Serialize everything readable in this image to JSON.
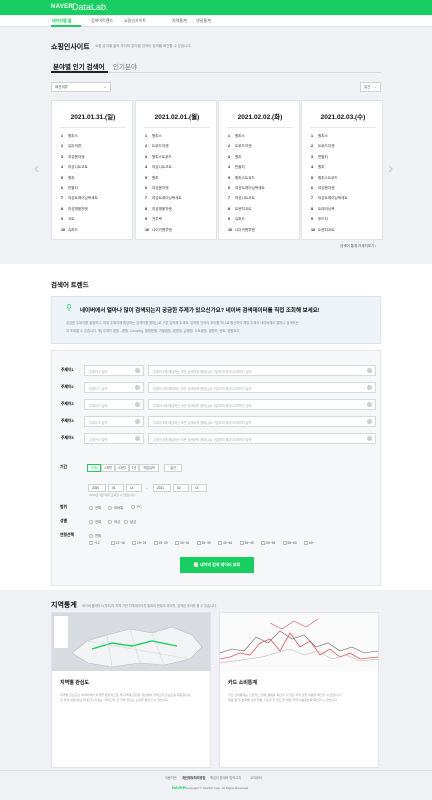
{
  "header": {
    "brand": "NAVER",
    "title": "DataLab."
  },
  "nav": [
    {
      "label": "데이터랩 홈"
    },
    {
      "label": "검색어트렌드"
    },
    {
      "label": "쇼핑인사이트"
    },
    {
      "label": "지역통계"
    },
    {
      "label": "댓글통계"
    }
  ],
  "shopping": {
    "title": "쇼핑인사이트",
    "desc": "쇼핑 분야별 클릭 추이와 분야별 검색어 정보를 확인할 수 있습니다.",
    "tabs": [
      {
        "label": "분야별 인기 검색어"
      },
      {
        "label": "인기분야"
      }
    ],
    "category_select": "패션의류",
    "period_select": "일간",
    "cards": [
      {
        "date": "2021.01.31.(일)",
        "items": [
          "원피스",
          "유아의류",
          "여성봄자켓",
          "여성니트코트",
          "원피",
          "반팔티",
          "여성트레이닝복세트",
          "여성명품자켓",
          "코트",
          "슈퍼드"
        ]
      },
      {
        "date": "2021.02.01.(월)",
        "items": [
          "원피스",
          "트위드자켓",
          "원피스트위드",
          "여성니트코트",
          "원피",
          "여성봄자켓",
          "여성트레이닝복세트",
          "여성명품자켓",
          "전투복",
          "나이키맨투맨"
        ]
      },
      {
        "date": "2021.02.02.(화)",
        "items": [
          "원피스",
          "트위드자켓",
          "원피",
          "반팔티",
          "원피스트위드",
          "여성트레이닝복세트",
          "여성니트코트",
          "트렌치코트",
          "슈퍼드",
          "나이키맨투맨"
        ]
      },
      {
        "date": "2021.02.03.(수)",
        "items": [
          "원피스",
          "트위드자켓",
          "반팔티",
          "원피",
          "원피스트위드",
          "여성봄자켓",
          "여성트레이닝복세트",
          "트레이닝복",
          "후드티",
          "트렌치코트"
        ]
      }
    ],
    "more": "검색어 통계 자세히보기 ›"
  },
  "trend": {
    "title": "검색어 트렌드",
    "banner_title": "네이버에서 얼마나 많이 검색되는지 궁금한 주제가 있으신가요? 네이버 검색데이터를 직접 조회해 보세요!",
    "banner_desc1": "궁금한 주제어를 설정하고, 하위 주제어에 해당하는 검색어를 콤마(,)로 구분 입력해 주세요. 입력한 단어의 추이를 하나로 합산하여 해당 주제가 네이버에서 얼마나 검색되는",
    "banner_desc2": "지 조회할 수 있습니다. 예) 주제어 캠핑 - 캠핑, Camping, 캠핑용품, 겨울캠핑, 캠핑장, 글램핑, 오토캠핑, 캠핑카, 텐트, 캠핑요리",
    "subjects": [
      {
        "label": "주제어1",
        "name_ph": "주제어 1 입력",
        "kw_ph": "주제어 1에 해당하는 모든 검색어를 콤마(,)로 구분하여 최대 20개까지 입력"
      },
      {
        "label": "주제어2",
        "name_ph": "주제어 2 입력",
        "kw_ph": "주제어 2에 해당하는 모든 검색어를 콤마(,)로 구분하여 최대 20개까지 입력"
      },
      {
        "label": "주제어3",
        "name_ph": "주제어 3 입력",
        "kw_ph": "주제어 3에 해당하는 모든 검색어를 콤마(,)로 구분하여 최대 20개까지 입력"
      },
      {
        "label": "주제어4",
        "name_ph": "주제어 4 입력",
        "kw_ph": "주제어 4에 해당하는 모든 검색어를 콤마(,)로 구분하여 최대 20개까지 입력"
      },
      {
        "label": "주제어5",
        "name_ph": "주제어 5 입력",
        "kw_ph": "주제어 5에 해당하는 모든 검색어를 콤마(,)로 구분하여 최대 20개까지 입력"
      }
    ],
    "period_label": "기간",
    "period_btns": [
      "전체",
      "1개월",
      "3개월",
      "1년",
      "직접입력"
    ],
    "period_unit": "일간",
    "start": {
      "year": "2020",
      "month": "01",
      "day": "14"
    },
    "end": {
      "year": "2021",
      "month": "02",
      "day": "14"
    },
    "period_note": "2016년 1월 이후 조회할 수 있습니다.",
    "range_label": "범위",
    "range_opts": [
      "전체",
      "모바일",
      "PC"
    ],
    "gender_label": "성별",
    "gender_opts": [
      "전체",
      "여성",
      "남성"
    ],
    "age_label": "연령선택",
    "age_all": "전체",
    "ages": [
      "~12",
      "13~18",
      "19~24",
      "25~29",
      "30~34",
      "35~39",
      "40~44",
      "45~49",
      "50~54",
      "55~60",
      "60~"
    ],
    "run_btn": "네이버 검색 데이터 조회"
  },
  "region": {
    "title": "지역통계",
    "desc": "네이버 플레이스(지도)의 지역 기반 지역데이터를 통하여 현황과 추이를, 검색된 추이를 볼 수 있습니다.",
    "cards": [
      {
        "title": "지역별 관심도",
        "desc1": "지역별 관심도는 네이버에서 지역을 명칭적으로 세 지역에 관련된 정보에서 카테고리 관심도를 제공합니다.",
        "desc2": "한 지역 내에 관심 카테고리 지표는, 카테고리 간 지역 관심도 수준을 확인할 수 있습니다."
      },
      {
        "title": "카드 소비통계",
        "desc1": "카드 소비통계는 신한카드 판매 결제를 확인할 수 있는 지역 관련 내용을 확인할 수 있습니다.",
        "desc2": "업종 별 및 분류별 소비 현황 수준과 주 카드 및 해당 지역 이용정보를 확인할 수 있습니다."
      }
    ]
  },
  "footer": {
    "links": [
      "이용약관",
      "개인정보처리방침",
      "책임의 한계와 법적고지",
      "고객센터"
    ],
    "logo": "NAVER",
    "copy": "Copyright © NAVER Corp. All Rights Reserved."
  },
  "colors": {
    "brand": "#19ce60",
    "bg": "#f0f1f4"
  }
}
